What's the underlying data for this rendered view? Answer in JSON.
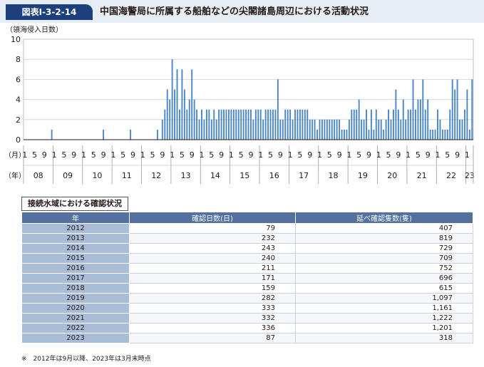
{
  "figure": {
    "number": "図表Ⅰ-3-2-14",
    "title": "中国海警局に所属する船舶などの尖閣諸島周辺における活動状況",
    "note": "※　2012年は9月以降、2023年は3月末時点"
  },
  "chart_data": {
    "type": "bar",
    "title": "中国海警局に所属する船舶などの尖閣諸島周辺における活動状況",
    "ylabel": "（領海侵入日数）",
    "ylim": [
      0,
      10
    ],
    "yticks": [
      0,
      2,
      4,
      6,
      8,
      10
    ],
    "grid": true,
    "month_axis_label": "（月）",
    "year_axis_label": "（年）",
    "month_ticks": [
      "1",
      "5",
      "9"
    ],
    "year_labels": [
      "08",
      "09",
      "10",
      "11",
      "12",
      "13",
      "14",
      "15",
      "16",
      "17",
      "18",
      "19",
      "20",
      "21",
      "22",
      "23"
    ],
    "start": "2008-01",
    "end": "2023-03",
    "series": [
      {
        "color": "#4a86c8",
        "values": {
          "2008-12": 1,
          "2010-09": 1,
          "2011-08": 1,
          "2012-07": 1,
          "2012-09": 2,
          "2012-10": 3,
          "2012-11": 5,
          "2012-12": 4,
          "2013-01": 8,
          "2013-02": 5,
          "2013-03": 7,
          "2013-04": 3,
          "2013-05": 7,
          "2013-06": 5,
          "2013-07": 3,
          "2013-08": 4,
          "2013-09": 7,
          "2013-10": 4,
          "2013-11": 3,
          "2013-12": 2,
          "2014-01": 3,
          "2014-02": 2,
          "2014-03": 3,
          "2014-04": 3,
          "2014-05": 2,
          "2014-06": 3,
          "2014-07": 2,
          "2014-08": 3,
          "2014-09": 3,
          "2014-10": 3,
          "2014-11": 3,
          "2014-12": 3,
          "2015-01": 3,
          "2015-02": 3,
          "2015-03": 3,
          "2015-04": 3,
          "2015-05": 3,
          "2015-06": 3,
          "2015-07": 3,
          "2015-08": 3,
          "2015-09": 3,
          "2015-10": 2,
          "2015-11": 3,
          "2015-12": 3,
          "2016-01": 3,
          "2016-02": 2,
          "2016-03": 3,
          "2016-04": 3,
          "2016-05": 3,
          "2016-06": 3,
          "2016-07": 3,
          "2016-08": 6,
          "2016-09": 2,
          "2016-10": 2,
          "2016-11": 3,
          "2016-12": 3,
          "2017-01": 3,
          "2017-02": 2,
          "2017-03": 3,
          "2017-04": 3,
          "2017-05": 3,
          "2017-06": 3,
          "2017-07": 3,
          "2017-08": 3,
          "2017-09": 2,
          "2017-10": 2,
          "2017-11": 2,
          "2017-12": 1,
          "2018-01": 2,
          "2018-02": 2,
          "2018-03": 2,
          "2018-04": 2,
          "2018-05": 2,
          "2018-06": 2,
          "2018-07": 2,
          "2018-08": 2,
          "2018-09": 2,
          "2018-10": 1,
          "2018-11": 1,
          "2018-12": 1,
          "2019-01": 2,
          "2019-02": 3,
          "2019-03": 3,
          "2019-04": 3,
          "2019-05": 4,
          "2019-06": 2,
          "2019-07": 2,
          "2019-08": 3,
          "2019-09": 1,
          "2019-10": 3,
          "2019-11": 1,
          "2019-12": 3,
          "2020-01": 2,
          "2020-02": 2,
          "2020-03": 1,
          "2020-04": 2,
          "2020-05": 3,
          "2020-06": 2,
          "2020-07": 3,
          "2020-08": 5,
          "2020-09": 3,
          "2020-10": 2,
          "2020-11": 4,
          "2020-12": 2,
          "2021-01": 3,
          "2021-02": 3,
          "2021-03": 6,
          "2021-04": 3,
          "2021-05": 4,
          "2021-06": 4,
          "2021-07": 6,
          "2021-08": 3,
          "2021-09": 4,
          "2021-10": 1,
          "2021-11": 1,
          "2021-12": 1,
          "2022-01": 3,
          "2022-02": 2,
          "2022-03": 1,
          "2022-04": 1,
          "2022-05": 1,
          "2022-06": 3,
          "2022-07": 6,
          "2022-08": 5,
          "2022-09": 6,
          "2022-10": 2,
          "2022-11": 2,
          "2022-12": 3,
          "2023-01": 5,
          "2023-02": 1,
          "2023-03": 6
        }
      }
    ]
  },
  "table": {
    "caption": "接続水域における確認状況",
    "headers": [
      "年",
      "確認日数(日)",
      "延べ確認隻数(隻)"
    ],
    "rows": [
      [
        "2012",
        "79",
        "407"
      ],
      [
        "2013",
        "232",
        "819"
      ],
      [
        "2014",
        "243",
        "729"
      ],
      [
        "2015",
        "240",
        "709"
      ],
      [
        "2016",
        "211",
        "752"
      ],
      [
        "2017",
        "171",
        "696"
      ],
      [
        "2018",
        "159",
        "615"
      ],
      [
        "2019",
        "282",
        "1,097"
      ],
      [
        "2020",
        "333",
        "1,161"
      ],
      [
        "2021",
        "332",
        "1,222"
      ],
      [
        "2022",
        "336",
        "1,201"
      ],
      [
        "2023",
        "87",
        "318"
      ]
    ]
  }
}
